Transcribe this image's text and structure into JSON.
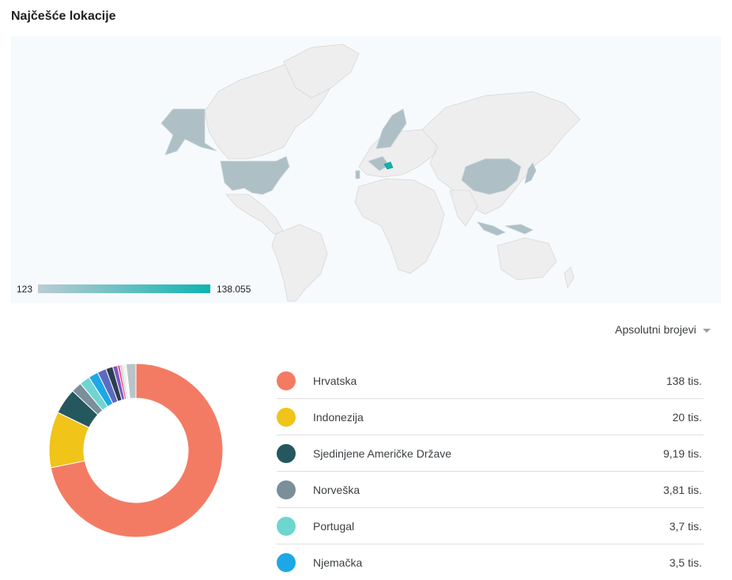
{
  "title": "Najčešće lokacije",
  "map": {
    "legend_min": "123",
    "legend_max": "138.055",
    "legend_color_low": "#bcccd3",
    "legend_color_high": "#0fb3b0",
    "highlighted": [
      "Croatia",
      "United States",
      "Alaska",
      "Norway",
      "Sweden",
      "Portugal",
      "Germany",
      "China",
      "Japan",
      "Indonesia"
    ]
  },
  "mode_select": "Apsolutni brojevi",
  "chart_data": {
    "type": "pie",
    "donut": true,
    "categories": [
      "Hrvatska",
      "Indonezija",
      "Sjedinjene Američke Države",
      "Norveška",
      "Portugal",
      "Njemačka"
    ],
    "values": [
      138000,
      20000,
      9190,
      3810,
      3700,
      3500
    ],
    "value_labels": [
      "138 tis.",
      "20 tis.",
      "9,19 tis.",
      "3,81 tis.",
      "3,7 tis.",
      "3,5 tis."
    ],
    "colors": [
      "#f37b63",
      "#f0c419",
      "#25575f",
      "#7a8f99",
      "#6dd6cf",
      "#1ea7e6"
    ],
    "other_values": [
      3200,
      2500,
      1700,
      900,
      700,
      600,
      500,
      400,
      3500
    ],
    "other_colors": [
      "#5c6bc0",
      "#2c3e50",
      "#7e57c2",
      "#e84a7f",
      "#b0bec5",
      "#cfd8dc",
      "#e0e0e0",
      "#d7ccc8",
      "#b8c4ca"
    ]
  }
}
